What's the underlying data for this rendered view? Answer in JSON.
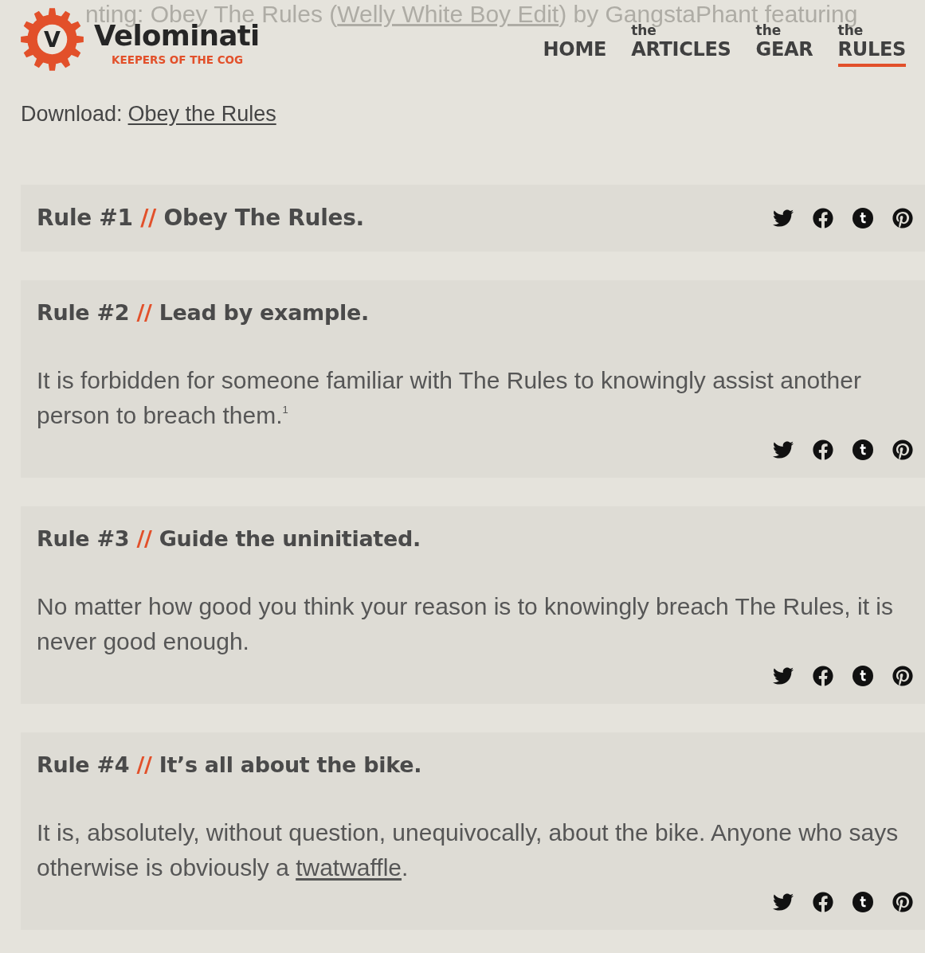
{
  "now_playing": {
    "text": "nting: Obey The Rules (",
    "link": "Welly White Boy Edit",
    "after": ") by GangstaPhant featuring"
  },
  "logo": {
    "mark": "V",
    "name": "Velominati",
    "tagline": "KEEPERS OF THE COG"
  },
  "nav": [
    {
      "label": "HOME",
      "selected": false
    },
    {
      "article": "the",
      "label": "ARTICLES",
      "selected": false
    },
    {
      "article": "the",
      "label": "GEAR",
      "selected": false
    },
    {
      "article": "the",
      "label": "RULES",
      "selected": true
    }
  ],
  "download": {
    "label": "Download:",
    "link": "Obey the Rules"
  },
  "rules": [
    {
      "number": "Rule #1",
      "separator": "//",
      "title": "Obey The Rules."
    },
    {
      "number": "Rule #2",
      "separator": "//",
      "title": "Lead by example.",
      "body": [
        {
          "kind": "text",
          "text": "It is forbidden for someone familiar with The Rules to knowingly assist another person to breach them.$^{1}$"
        }
      ]
    },
    {
      "number": "Rule #3",
      "separator": "//",
      "title": "Guide the uninitiated.",
      "body": [
        {
          "kind": "text",
          "text": "No matter how good you think your reason is to knowingly breach The Rules, it is never good enough."
        }
      ]
    },
    {
      "number": "Rule #4",
      "separator": "//",
      "title": "It’s all about the bike.",
      "body": [
        {
          "kind": "text",
          "text": "It is, absolutely, without question, unequivocally, about the bike. Anyone who says otherwise is obviously a "
        },
        {
          "kind": "link",
          "text": "twatwaffle"
        },
        {
          "kind": "text",
          "text": "."
        }
      ]
    }
  ]
}
